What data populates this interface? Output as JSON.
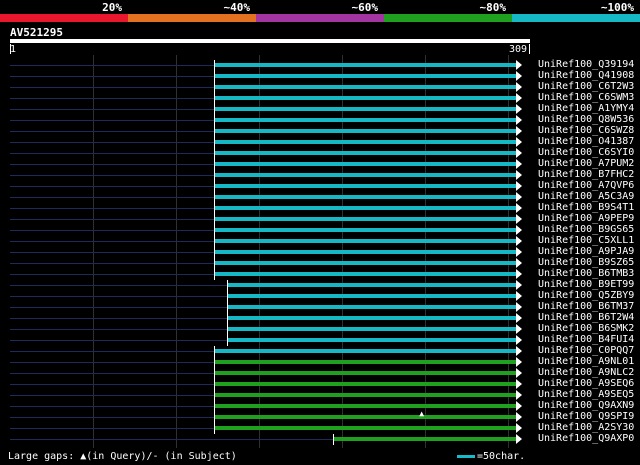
{
  "legend": {
    "segments": [
      {
        "label": "20%",
        "color": "#e8172d"
      },
      {
        "label": "~40%",
        "color": "#e37220"
      },
      {
        "label": "~60%",
        "color": "#a235a0"
      },
      {
        "label": "~80%",
        "color": "#1fa01f"
      },
      {
        "label": "~100%",
        "color": "#17b8c6"
      }
    ]
  },
  "query": {
    "id": "AV521295",
    "start_label": "1",
    "end_label": "309",
    "length": 309
  },
  "hits": [
    {
      "name": "UniRef100_Q39194",
      "start": 124,
      "end": 309,
      "color": "#17b8c6"
    },
    {
      "name": "UniRef100_Q41908",
      "start": 124,
      "end": 309,
      "color": "#17b8c6"
    },
    {
      "name": "UniRef100_C6T2W3",
      "start": 124,
      "end": 309,
      "color": "#17b8c6"
    },
    {
      "name": "UniRef100_C6SWM3",
      "start": 124,
      "end": 309,
      "color": "#17b8c6"
    },
    {
      "name": "UniRef100_A1YMY4",
      "start": 124,
      "end": 309,
      "color": "#17b8c6"
    },
    {
      "name": "UniRef100_Q8W536",
      "start": 124,
      "end": 309,
      "color": "#17b8c6"
    },
    {
      "name": "UniRef100_C6SWZ8",
      "start": 124,
      "end": 309,
      "color": "#17b8c6"
    },
    {
      "name": "UniRef100_O41387",
      "start": 124,
      "end": 309,
      "color": "#17b8c6"
    },
    {
      "name": "UniRef100_C6SYI0",
      "start": 124,
      "end": 309,
      "color": "#17b8c6"
    },
    {
      "name": "UniRef100_A7PUM2",
      "start": 124,
      "end": 309,
      "color": "#17b8c6"
    },
    {
      "name": "UniRef100_B7FHC2",
      "start": 124,
      "end": 309,
      "color": "#17b8c6"
    },
    {
      "name": "UniRef100_A7QVP6",
      "start": 124,
      "end": 309,
      "color": "#17b8c6"
    },
    {
      "name": "UniRef100_A5C3A9",
      "start": 124,
      "end": 309,
      "color": "#17b8c6"
    },
    {
      "name": "UniRef100_B9S4T1",
      "start": 124,
      "end": 309,
      "color": "#17b8c6"
    },
    {
      "name": "UniRef100_A9PEP9",
      "start": 124,
      "end": 309,
      "color": "#17b8c6"
    },
    {
      "name": "UniRef100_B9GS65",
      "start": 124,
      "end": 309,
      "color": "#17b8c6"
    },
    {
      "name": "UniRef100_C5XLL1",
      "start": 124,
      "end": 309,
      "color": "#17b8c6"
    },
    {
      "name": "UniRef100_A9PJA9",
      "start": 124,
      "end": 309,
      "color": "#17b8c6"
    },
    {
      "name": "UniRef100_B9SZ65",
      "start": 124,
      "end": 309,
      "color": "#17b8c6"
    },
    {
      "name": "UniRef100_B6TMB3",
      "start": 124,
      "end": 309,
      "color": "#17b8c6"
    },
    {
      "name": "UniRef100_B9ET99",
      "start": 132,
      "end": 309,
      "color": "#17b8c6"
    },
    {
      "name": "UniRef100_Q5ZBY9",
      "start": 132,
      "end": 309,
      "color": "#17b8c6"
    },
    {
      "name": "UniRef100_B6TM37",
      "start": 132,
      "end": 309,
      "color": "#17b8c6"
    },
    {
      "name": "UniRef100_B6T2W4",
      "start": 132,
      "end": 309,
      "color": "#17b8c6"
    },
    {
      "name": "UniRef100_B6SMK2",
      "start": 132,
      "end": 309,
      "color": "#17b8c6"
    },
    {
      "name": "UniRef100_B4FUI4",
      "start": 132,
      "end": 309,
      "color": "#17b8c6"
    },
    {
      "name": "UniRef100_C0PQQ7",
      "start": 124,
      "end": 309,
      "color": "#17b8c6"
    },
    {
      "name": "UniRef100_A9NL01",
      "start": 124,
      "end": 309,
      "color": "#1fa01f"
    },
    {
      "name": "UniRef100_A9NLC2",
      "start": 124,
      "end": 309,
      "color": "#1fa01f"
    },
    {
      "name": "UniRef100_A9SEQ6",
      "start": 124,
      "end": 309,
      "color": "#1fa01f"
    },
    {
      "name": "UniRef100_A9SEQ5",
      "start": 124,
      "end": 309,
      "color": "#1fa01f"
    },
    {
      "name": "UniRef100_Q9AXN9",
      "start": 124,
      "end": 309,
      "color": "#1fa01f"
    },
    {
      "name": "UniRef100_Q9SPI9",
      "start": 124,
      "end": 309,
      "color": "#1fa01f",
      "gap": 250
    },
    {
      "name": "UniRef100_A2SY30",
      "start": 124,
      "end": 309,
      "color": "#1fa01f"
    },
    {
      "name": "UniRef100_Q9AXP0",
      "start": 196,
      "end": 309,
      "color": "#1fa01f"
    }
  ],
  "footer": {
    "gaps_text": "Large gaps: ▲(in Query)/- (in Subject)",
    "scale_text": "=50char."
  }
}
